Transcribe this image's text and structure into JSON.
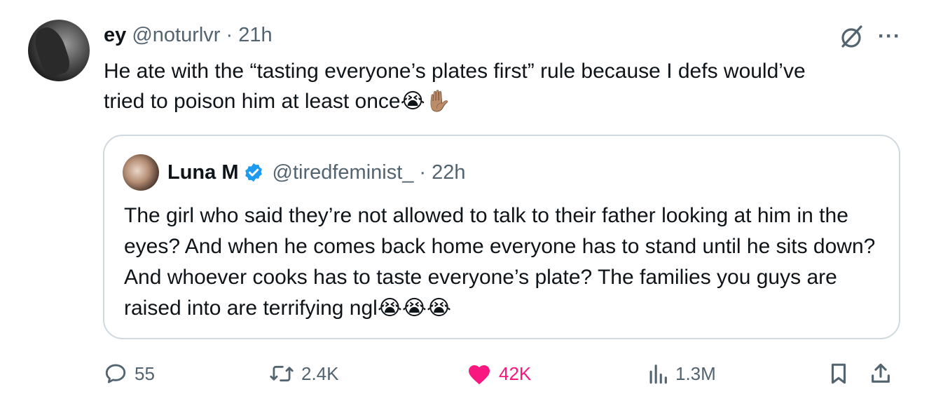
{
  "tweet": {
    "display_name": "ey",
    "handle": "@noturlvr",
    "time": "21h",
    "separator": "·",
    "text": "He ate with the “tasting everyone’s plates first” rule because I defs would’ve tried to poison him at least once",
    "emojis": "😭✋🏽"
  },
  "quote": {
    "display_name": "Luna M",
    "handle": "@tiredfeminist_",
    "time": "22h",
    "separator": "·",
    "text": "The girl who said they’re not allowed to talk to their father looking at him in the eyes? And when he comes back home everyone has to stand until he sits down? And whoever cooks has to taste everyone’s plate? The families you guys are raised into are terrifying ngl",
    "emojis": "😭😭😭"
  },
  "actions": {
    "replies": "55",
    "reposts": "2.4K",
    "likes": "42K",
    "views": "1.3M"
  },
  "icons": {
    "top": [
      "grok-icon",
      "more-icon"
    ],
    "bar": [
      "reply-icon",
      "repost-icon",
      "like-icon",
      "views-icon",
      "bookmark-icon",
      "share-icon"
    ]
  },
  "colors": {
    "text": "#0f1419",
    "muted": "#536471",
    "like": "#f91880",
    "verified": "#1d9bf0",
    "border": "#cfd9de"
  }
}
